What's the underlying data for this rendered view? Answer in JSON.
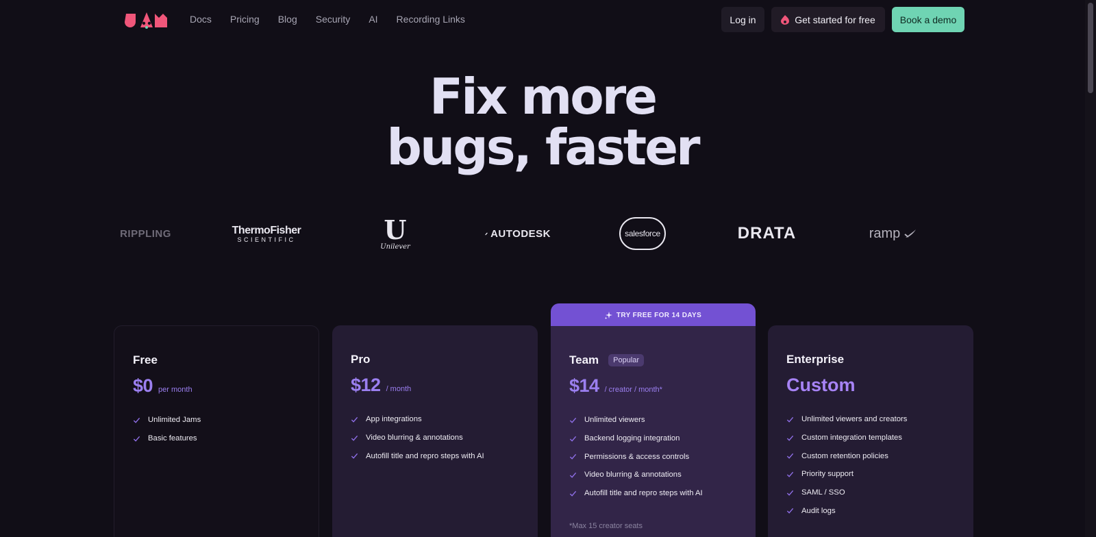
{
  "nav": {
    "links": [
      "Docs",
      "Pricing",
      "Blog",
      "Security",
      "AI",
      "Recording Links"
    ],
    "login": "Log in",
    "get_started": "Get started for free",
    "demo": "Book a demo",
    "brand_color": "#f0567a",
    "demo_color": "#6fd4b3"
  },
  "hero": {
    "line1": "Fix more",
    "line2": "bugs, faster"
  },
  "logos": {
    "rippling": "RIPPLING",
    "thermo_main": "ThermoFisher",
    "thermo_sub": "SCIENTIFIC",
    "unilever_mark": "U",
    "unilever": "Unilever",
    "autodesk": "AUTODESK",
    "salesforce": "salesforce",
    "drata": "DRATA",
    "ramp": "ramp"
  },
  "pricing": {
    "team_banner": "TRY FREE FOR 14 DAYS",
    "plans": [
      {
        "name": "Free",
        "price": "$0",
        "unit": "per month",
        "features": [
          "Unlimited Jams",
          "Basic features"
        ]
      },
      {
        "name": "Pro",
        "price": "$12",
        "unit": "/ month",
        "features": [
          "App integrations",
          "Video blurring & annotations",
          "Autofill title and repro steps with AI"
        ]
      },
      {
        "name": "Team",
        "badge": "Popular",
        "price": "$14",
        "unit": "/ creator / month*",
        "features": [
          "Unlimited viewers",
          "Backend logging integration",
          "Permissions & access controls",
          "Video blurring & annotations",
          "Autofill title and repro steps with AI"
        ],
        "footnote": "*Max 15 creator seats"
      },
      {
        "name": "Enterprise",
        "price": "Custom",
        "features": [
          "Unlimited viewers and creators",
          "Custom integration templates",
          "Custom retention policies",
          "Priority support",
          "SAML / SSO",
          "Audit logs"
        ]
      }
    ]
  }
}
